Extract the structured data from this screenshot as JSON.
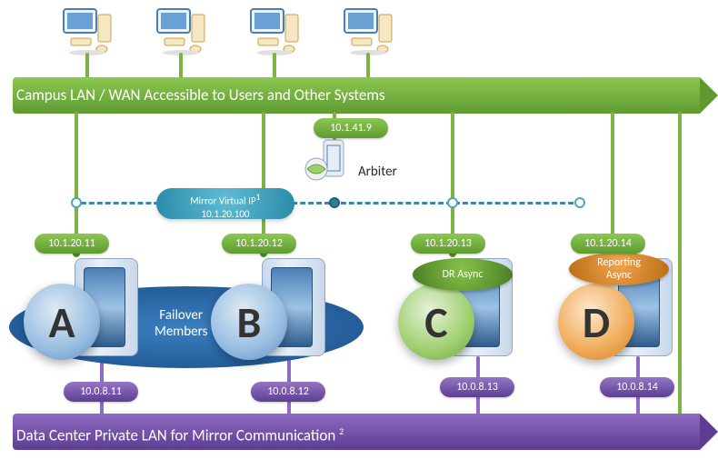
{
  "network": {
    "lan_label": "Campus LAN / WAN Accessible to Users and Other Systems",
    "private_label": "Data Center Private LAN for Mirror Communication",
    "private_sup": "2"
  },
  "arbiter": {
    "label": "Arbiter",
    "ip": "10.1.41.9"
  },
  "vip": {
    "line1": "Mirror Virtual IP",
    "sup": "1",
    "line2": "10.1.20.100"
  },
  "failover": {
    "line1": "Failover",
    "line2": "Members"
  },
  "servers": {
    "a": {
      "letter": "A",
      "top_ip": "10.1.20.11",
      "bottom_ip": "10.0.8.11"
    },
    "b": {
      "letter": "B",
      "top_ip": "10.1.20.12",
      "bottom_ip": "10.0.8.12"
    },
    "c": {
      "letter": "C",
      "top_ip": "10.1.20.13",
      "bottom_ip": "10.0.8.13",
      "badge": "DR Async"
    },
    "d": {
      "letter": "D",
      "top_ip": "10.1.20.14",
      "bottom_ip": "10.0.8.14",
      "badge1": "Reporting",
      "badge2": "Async"
    }
  },
  "chart_data": {
    "type": "network-diagram",
    "description": "InterSystems mirror topology with four database servers connected to a Campus LAN (top, green) and a private mirror LAN (bottom, purple).",
    "top_bus": {
      "label": "Campus LAN / WAN Accessible to Users and Other Systems",
      "color": "#6fa83a"
    },
    "bottom_bus": {
      "label": "Data Center Private LAN for Mirror Communication",
      "color": "#6b4aa0",
      "footnote_ref": 2
    },
    "arbiter": {
      "role": "Arbiter",
      "lan_ip": "10.1.41.9"
    },
    "virtual_ip": {
      "label": "Mirror Virtual IP",
      "address": "10.1.20.100",
      "footnote_ref": 1,
      "shared_by": [
        "A",
        "B"
      ],
      "dashed_link_to": [
        "Arbiter",
        "C",
        "D"
      ]
    },
    "failover_members": [
      "A",
      "B"
    ],
    "nodes": [
      {
        "id": "A",
        "role": "Failover Member",
        "lan_ip": "10.1.20.11",
        "mirror_ip": "10.0.8.11",
        "color": "blue"
      },
      {
        "id": "B",
        "role": "Failover Member",
        "lan_ip": "10.1.20.12",
        "mirror_ip": "10.0.8.12",
        "color": "blue"
      },
      {
        "id": "C",
        "role": "DR Async",
        "lan_ip": "10.1.20.13",
        "mirror_ip": "10.0.8.13",
        "color": "green"
      },
      {
        "id": "D",
        "role": "Reporting Async",
        "lan_ip": "10.1.20.14",
        "mirror_ip": "10.0.8.14",
        "color": "orange"
      }
    ],
    "clients": 4
  }
}
